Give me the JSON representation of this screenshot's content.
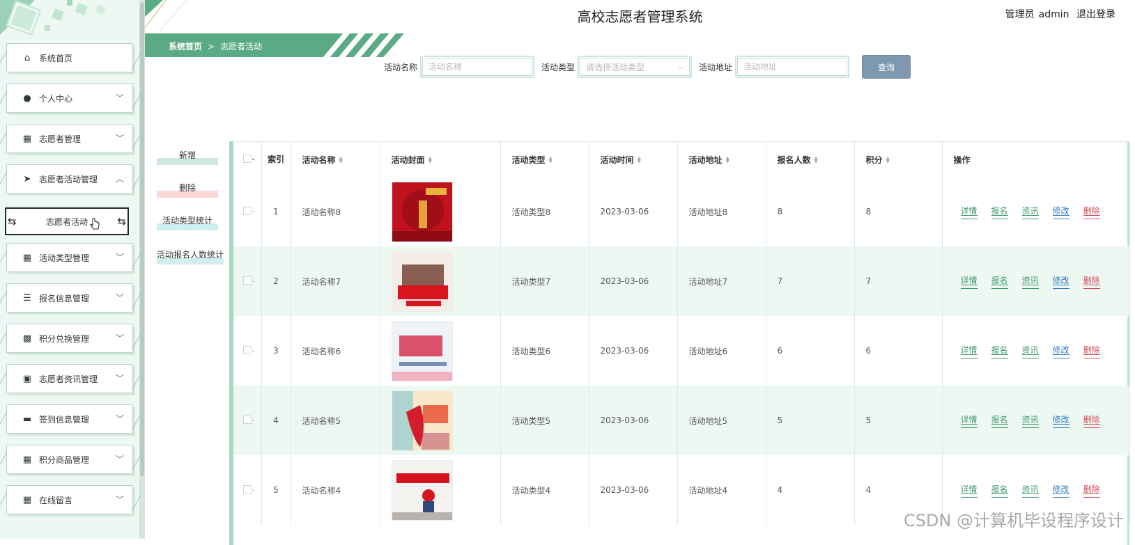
{
  "header": {
    "title": "高校志愿者管理系统",
    "role": "管理员",
    "username": "admin",
    "logout": "退出登录"
  },
  "sidebar": {
    "items": [
      {
        "label": "系统首页",
        "icon": "home-icon",
        "has_children": false,
        "expanded": false
      },
      {
        "label": "个人中心",
        "icon": "user-icon",
        "has_children": true,
        "expanded": false
      },
      {
        "label": "志愿者管理",
        "icon": "grid-icon",
        "has_children": true,
        "expanded": false
      },
      {
        "label": "志愿者活动管理",
        "icon": "send-icon",
        "has_children": true,
        "expanded": true
      },
      {
        "label": "活动类型管理",
        "icon": "grid-icon",
        "has_children": true,
        "expanded": false
      },
      {
        "label": "报名信息管理",
        "icon": "sliders-icon",
        "has_children": true,
        "expanded": false
      },
      {
        "label": "积分兑换管理",
        "icon": "apps-icon",
        "has_children": true,
        "expanded": false
      },
      {
        "label": "志愿者资讯管理",
        "icon": "clipboard-icon",
        "has_children": true,
        "expanded": false
      },
      {
        "label": "签到信息管理",
        "icon": "briefcase-icon",
        "has_children": true,
        "expanded": false
      },
      {
        "label": "积分商品管理",
        "icon": "grid-icon",
        "has_children": true,
        "expanded": false
      },
      {
        "label": "在线留言",
        "icon": "grid-icon",
        "has_children": true,
        "expanded": false
      }
    ],
    "active_sub": "志愿者活动"
  },
  "breadcrumb": {
    "home": "系统首页",
    "separator": ">",
    "current": "志愿者活动"
  },
  "search": {
    "name_label": "活动名称",
    "name_placeholder": "活动名称",
    "name_value": "",
    "type_label": "活动类型",
    "type_placeholder": "请选择活动类型",
    "addr_label": "活动地址",
    "addr_placeholder": "活动地址",
    "addr_value": "",
    "button": "查询"
  },
  "actions": {
    "add": "新增",
    "delete": "删除",
    "type_stats": "活动类型统计",
    "signup_stats": "活动报名人数统计"
  },
  "table": {
    "columns": {
      "index": "索引",
      "name": "活动名称",
      "cover": "活动封面",
      "type": "活动类型",
      "time": "活动时间",
      "addr": "活动地址",
      "count": "报名人数",
      "points": "积分",
      "ops": "操作"
    },
    "ops": {
      "detail": "详情",
      "signup": "报名",
      "news": "资讯",
      "edit": "修改",
      "delete": "删除"
    },
    "rows": [
      {
        "index": "1",
        "name": "活动名称8",
        "type": "活动类型8",
        "time": "2023-03-06",
        "addr": "活动地址8",
        "count": "8",
        "points": "8",
        "cover_color": "#c0121d"
      },
      {
        "index": "2",
        "name": "活动名称7",
        "type": "活动类型7",
        "time": "2023-03-06",
        "addr": "活动地址7",
        "count": "7",
        "points": "7",
        "cover_color": "#f3e7e2"
      },
      {
        "index": "3",
        "name": "活动名称6",
        "type": "活动类型6",
        "time": "2023-03-06",
        "addr": "活动地址6",
        "count": "6",
        "points": "6",
        "cover_color": "#eef3f8"
      },
      {
        "index": "4",
        "name": "活动名称5",
        "type": "活动类型5",
        "time": "2023-03-06",
        "addr": "活动地址5",
        "count": "5",
        "points": "5",
        "cover_color": "#f7e9c7"
      },
      {
        "index": "5",
        "name": "活动名称4",
        "type": "活动类型4",
        "time": "2023-03-06",
        "addr": "活动地址4",
        "count": "4",
        "points": "4",
        "cover_color": "#f5f3f0"
      }
    ]
  },
  "watermark": "CSDN @计算机毕设程序设计",
  "colors": {
    "accent": "#5aaa83",
    "sidebar_bg": "#eef8f3",
    "row_alt": "#eef8f3",
    "search_btn": "#7d98b0",
    "op_green": "#3d9a6c",
    "op_blue": "#2f7cc1",
    "op_red": "#d24b57"
  }
}
